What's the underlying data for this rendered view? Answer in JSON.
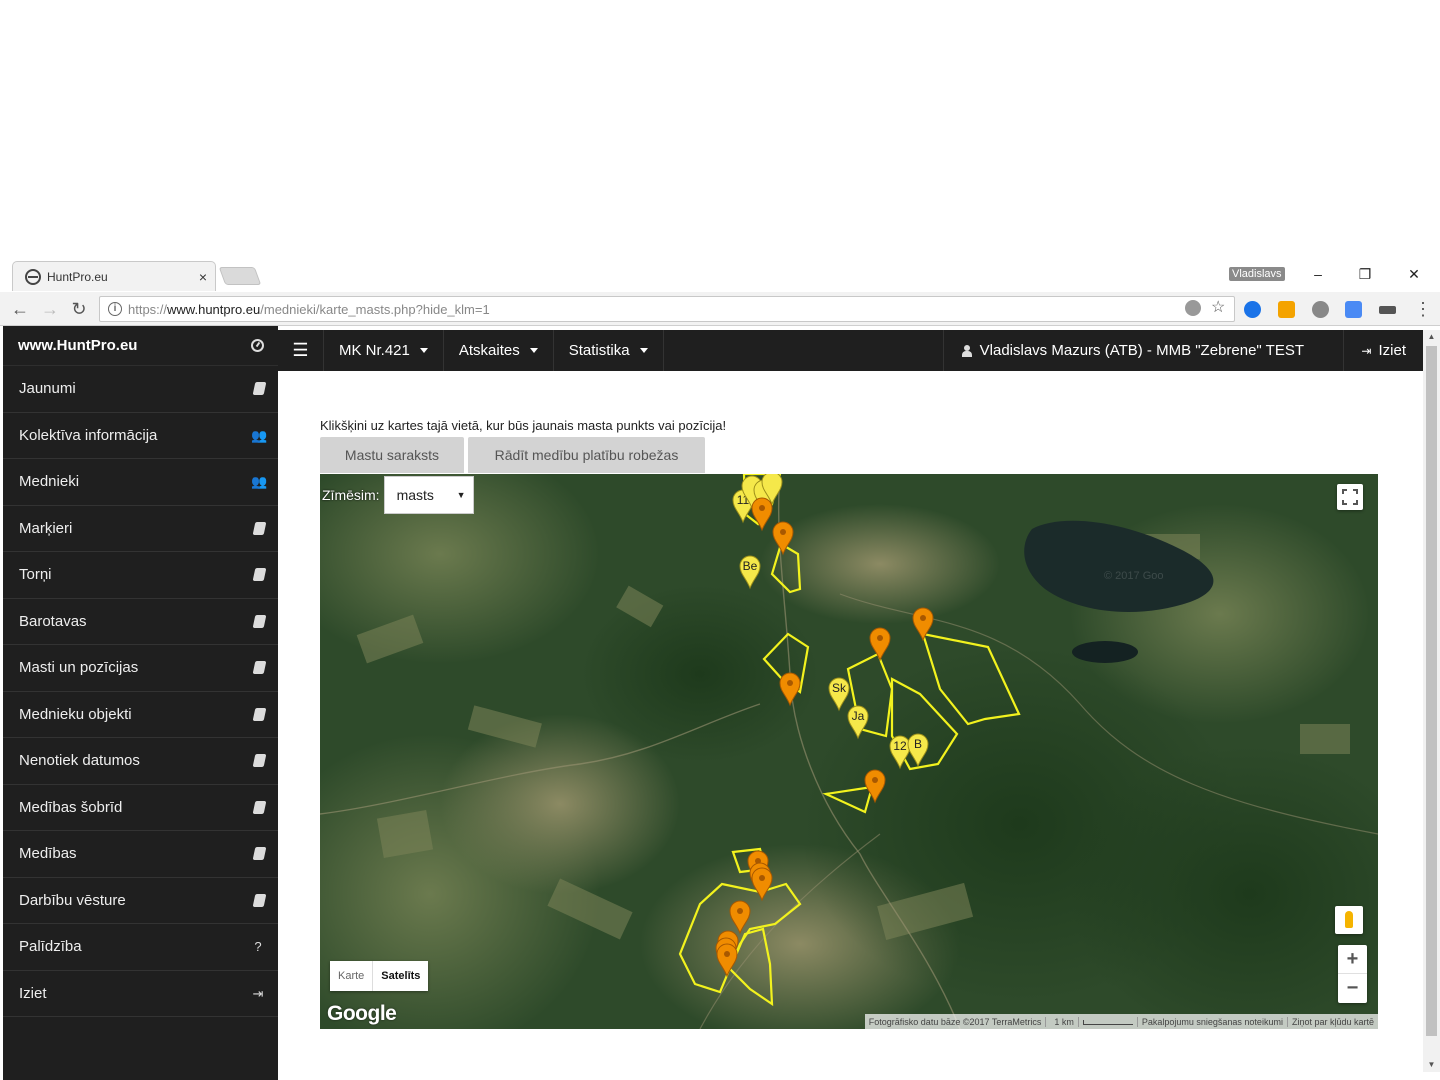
{
  "browser": {
    "tab_title": "HuntPro.eu",
    "tab_close": "×",
    "window_user": "Vladislavs",
    "url_scheme": "https://",
    "url_host": "www.huntpro.eu",
    "url_path": "/mednieki/karte_masts.php?hide_klm=1",
    "minimize": "–",
    "restore": "❐",
    "close": "✕",
    "back": "←",
    "forward": "→",
    "reload": "↻",
    "menu": "⋮"
  },
  "sidebar": {
    "brand": "www.HuntPro.eu",
    "items": [
      {
        "label": "Jaunumi",
        "icon": "book-icon"
      },
      {
        "label": "Kolektīva informācija",
        "icon": "users-icon"
      },
      {
        "label": "Mednieki",
        "icon": "users-icon"
      },
      {
        "label": "Marķieri",
        "icon": "book-icon"
      },
      {
        "label": "Torņi",
        "icon": "book-icon"
      },
      {
        "label": "Barotavas",
        "icon": "book-icon"
      },
      {
        "label": "Masti un pozīcijas",
        "icon": "book-icon"
      },
      {
        "label": "Mednieku objekti",
        "icon": "book-icon"
      },
      {
        "label": "Nenotiek datumos",
        "icon": "book-icon"
      },
      {
        "label": "Medības šobrīd",
        "icon": "book-icon"
      },
      {
        "label": "Medības",
        "icon": "book-icon"
      },
      {
        "label": "Darbību vēsture",
        "icon": "book-icon"
      },
      {
        "label": "Palīdzība",
        "icon": "question-icon"
      },
      {
        "label": "Iziet",
        "icon": "logout-icon"
      }
    ]
  },
  "topnav": {
    "menu_1": "MK Nr.421",
    "menu_2": "Atskaites",
    "menu_3": "Statistika",
    "user": "Vladislavs Mazurs (ATB) - MMB \"Zebrene\" TEST",
    "logout": "Iziet"
  },
  "content": {
    "instruction": "Klikšķini uz kartes tajā vietā, kur būs jaunais masta punkts vai pozīcija!",
    "tab_list": "Mastu saraksts",
    "tab_bounds": "Rādīt medību platību robežas"
  },
  "map": {
    "draw_label": "Zīmēsim:",
    "draw_value": "masts",
    "maptype_map": "Karte",
    "maptype_sat": "Satelīts",
    "zoom_in": "+",
    "zoom_out": "−",
    "logo": "Google",
    "attribution_1": "Fotogrāfisko datu bāze ©2017 TerraMetrics",
    "attribution_scale": "1 km",
    "attribution_2": "Pakalpojumu sniegšanas noteikumi",
    "attribution_3": "Ziņot par kļūdu kartē",
    "watermark": "© 2017 Goo",
    "marker_labels": [
      "11",
      "Be",
      "Sk",
      "Ja",
      "12",
      "B"
    ],
    "colors": {
      "boundary": "#f2f21e",
      "marker_orange": "#f08c00",
      "marker_yellow": "#f5e84a"
    }
  }
}
